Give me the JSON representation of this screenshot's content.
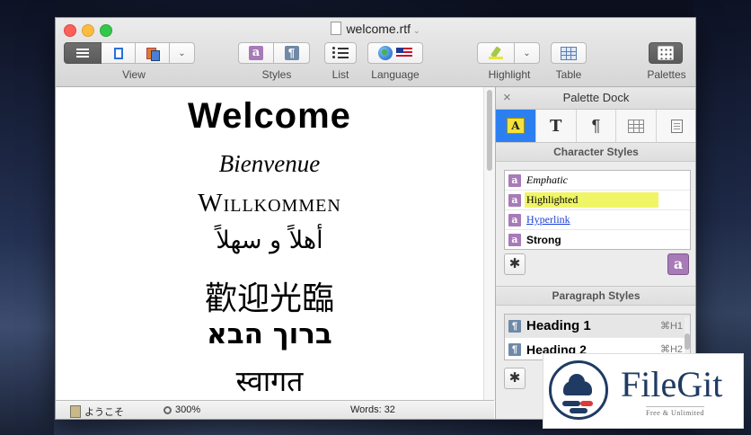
{
  "window": {
    "title": "welcome.rtf"
  },
  "toolbar": {
    "view_label": "View",
    "styles_label": "Styles",
    "list_label": "List",
    "language_label": "Language",
    "highlight_label": "Highlight",
    "table_label": "Table",
    "palettes_label": "Palettes",
    "styles_char_glyph": "a",
    "styles_para_glyph": "¶"
  },
  "document": {
    "lines": [
      "Welcome",
      "Bienvenue",
      "Willkommen",
      "أهلاً و سهلاً",
      "歡迎光臨",
      "ברוך הבא",
      "स्वागत"
    ]
  },
  "statusbar": {
    "clip_text": "ようこそ",
    "zoom": "300%",
    "words": "Words: 32"
  },
  "palette": {
    "title": "Palette Dock",
    "close_glyph": "×",
    "tabs": [
      "A",
      "T",
      "¶",
      "table",
      "page"
    ],
    "character_styles_title": "Character Styles",
    "character_styles": [
      {
        "name": "Emphatic"
      },
      {
        "name": "Highlighted"
      },
      {
        "name": "Hyperlink"
      },
      {
        "name": "Strong"
      }
    ],
    "paragraph_styles_title": "Paragraph Styles",
    "paragraph_styles": [
      {
        "name": "Heading 1",
        "shortcut": "⌘H1"
      },
      {
        "name": "Heading 2",
        "shortcut": "⌘H2"
      }
    ],
    "style_icon_glyph": "a",
    "para_icon_glyph": "¶",
    "gear_glyph": "✱",
    "add_glyph": "a"
  },
  "watermark": {
    "name": "FileGit",
    "tagline": "Free & Unlimited"
  },
  "colors": {
    "highlight_yellow": "#f0f566",
    "hyperlink_blue": "#1a3fd6",
    "active_tab_blue": "#2c7ff0",
    "brand_navy": "#1f3b63"
  }
}
